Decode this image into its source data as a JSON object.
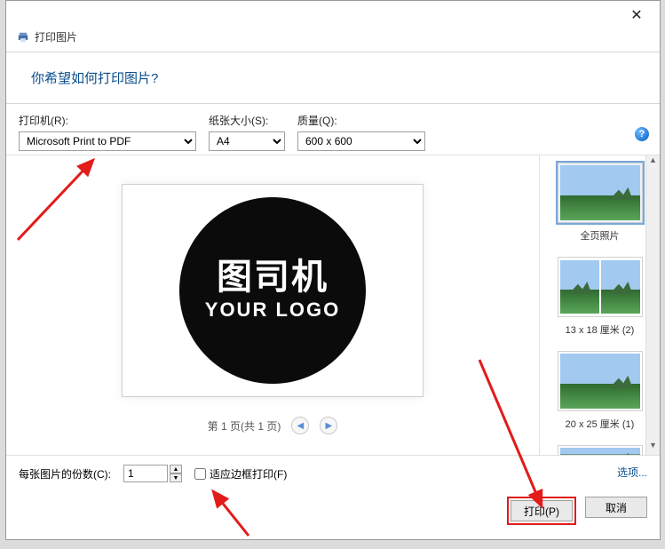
{
  "window": {
    "subtitle": "打印图片"
  },
  "header": {
    "title": "你希望如何打印图片?"
  },
  "labels": {
    "printer": "打印机(R):",
    "paper": "纸张大小(S):",
    "quality": "质量(Q):"
  },
  "selects": {
    "printer_value": "Microsoft Print to PDF",
    "paper_value": "A4",
    "quality_value": "600 x 600"
  },
  "preview": {
    "logo_cn": "图司机",
    "logo_en": "YOUR LOGO",
    "pager_text": "第 1 页(共 1 页)"
  },
  "layouts": [
    {
      "label": "全页照片"
    },
    {
      "label": "13 x 18 厘米 (2)"
    },
    {
      "label": "20 x 25 厘米 (1)"
    }
  ],
  "bottom": {
    "copies_label": "每张图片的份数(C):",
    "copies_value": "1",
    "fit_label": "适应边框打印(F)",
    "options_link": "选项..."
  },
  "buttons": {
    "print": "打印(P)",
    "cancel": "取消"
  }
}
